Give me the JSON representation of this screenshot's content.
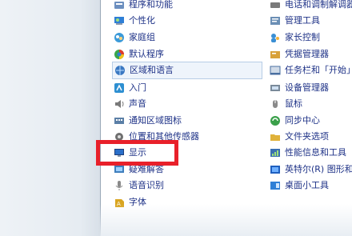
{
  "col1": [
    {
      "label": "程序和功能",
      "icon": "programs-icon",
      "color": "#6c8fbf"
    },
    {
      "label": "个性化",
      "icon": "personalization-icon",
      "color": "#2f7fd6"
    },
    {
      "label": "家庭组",
      "icon": "homegroup-icon",
      "color": "#3b9ad9"
    },
    {
      "label": "默认程序",
      "icon": "default-programs-icon",
      "color": "#3aa64a"
    },
    {
      "label": "区域和语言",
      "icon": "region-language-icon",
      "color": "#3a78c2"
    },
    {
      "label": "入门",
      "icon": "getting-started-icon",
      "color": "#2d8fd1"
    },
    {
      "label": "声音",
      "icon": "speaker-icon",
      "color": "#7a7a7a"
    },
    {
      "label": "通知区域图标",
      "icon": "notification-area-icon",
      "color": "#5b7fa6"
    },
    {
      "label": "位置和其他传感器",
      "icon": "sensor-icon",
      "color": "#6f6f6f"
    },
    {
      "label": "显示",
      "icon": "display-icon",
      "color": "#2a6fc9"
    },
    {
      "label": "疑难解答",
      "icon": "troubleshooting-icon",
      "color": "#3f7ebd"
    },
    {
      "label": "语音识别",
      "icon": "microphone-icon",
      "color": "#8a8a8a"
    },
    {
      "label": "字体",
      "icon": "fonts-icon",
      "color": "#d9a520"
    }
  ],
  "col2": [
    {
      "label": "电话和调制解调器",
      "icon": "phone-modem-icon",
      "color": "#7a7a7a"
    },
    {
      "label": "管理工具",
      "icon": "admin-tools-icon",
      "color": "#6b8fb5"
    },
    {
      "label": "家长控制",
      "icon": "parental-controls-icon",
      "color": "#3a8fd4"
    },
    {
      "label": "凭据管理器",
      "icon": "credential-manager-icon",
      "color": "#d8a13a"
    },
    {
      "label": "任务栏和「开始」菜单",
      "icon": "taskbar-icon",
      "color": "#4a6fa0"
    },
    {
      "label": "设备管理器",
      "icon": "device-manager-icon",
      "color": "#7a8a9a"
    },
    {
      "label": "鼠标",
      "icon": "mouse-icon",
      "color": "#8a8a8a"
    },
    {
      "label": "同步中心",
      "icon": "sync-center-icon",
      "color": "#3aa04a"
    },
    {
      "label": "文件夹选项",
      "icon": "folder-options-icon",
      "color": "#e0b23a"
    },
    {
      "label": "性能信息和工具",
      "icon": "performance-icon",
      "color": "#3a6fb0"
    },
    {
      "label": "英特尔(R) 图形和媒体",
      "icon": "intel-graphics-icon",
      "color": "#1f5fbf"
    },
    {
      "label": "桌面小工具",
      "icon": "gadgets-icon",
      "color": "#2f7fd6"
    }
  ],
  "highlight_color": "#e8202a",
  "selected_item": "区域和语言"
}
